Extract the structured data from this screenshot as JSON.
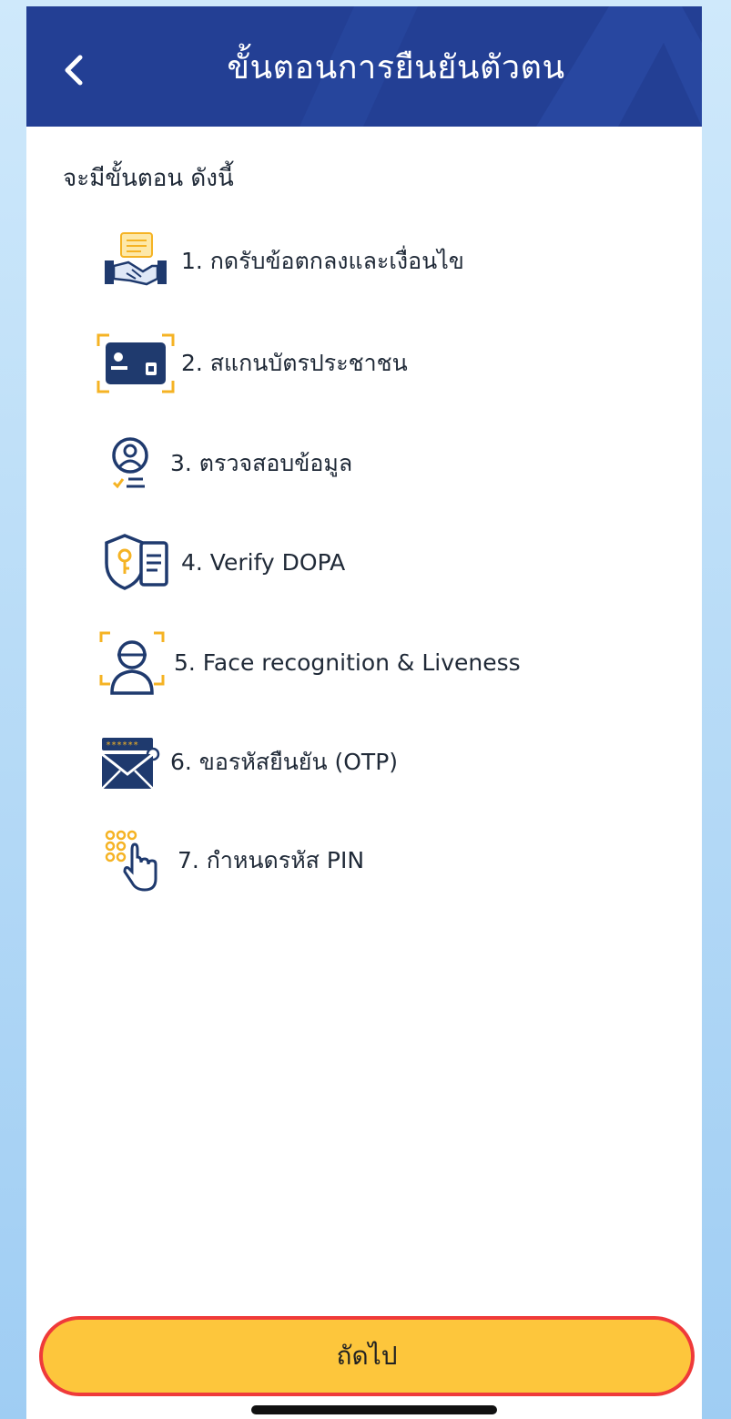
{
  "header": {
    "title": "ขั้นตอนการยืนยันตัวตน",
    "back_icon": "chevron-left-icon",
    "background": "#233f94"
  },
  "intro_text": "จะมีขั้นตอน ดังนี้",
  "steps": [
    {
      "label": "1. กดรับข้อตกลงและเงื่อนไข",
      "icon": "handshake-agreement-icon"
    },
    {
      "label": "2. สแกนบัตรประชาชน",
      "icon": "id-card-scan-icon"
    },
    {
      "label": "3. ตรวจสอบข้อมูล",
      "icon": "user-verify-icon"
    },
    {
      "label": "4. Verify DOPA",
      "icon": "shield-id-icon"
    },
    {
      "label": "5. Face recognition & Liveness",
      "icon": "face-scan-icon"
    },
    {
      "label": "6. ขอรหัสยืนยัน (OTP)",
      "icon": "otp-envelope-icon"
    },
    {
      "label": "7. กำหนดรหัส PIN",
      "icon": "pin-keypad-icon"
    }
  ],
  "next_button": {
    "label": "ถัดไป",
    "background": "#fdc63c",
    "highlight": "#ef3a3a"
  },
  "colors": {
    "navy": "#233f94",
    "gold": "#f5b324",
    "icon_dark": "#1f3a6e"
  }
}
